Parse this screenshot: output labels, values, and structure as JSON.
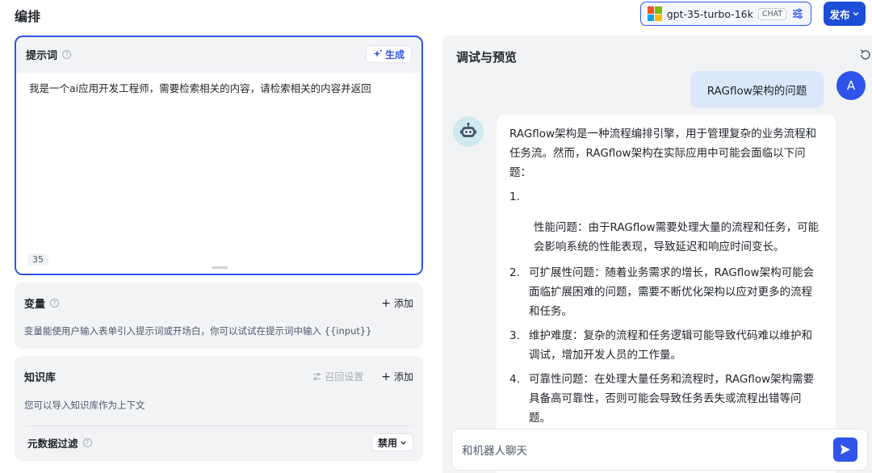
{
  "header": {
    "title": "编排",
    "model": {
      "name": "gpt-35-turbo-16k",
      "badge": "CHAT",
      "icon": "microsoft-logo"
    },
    "publish_label": "发布",
    "colors": {
      "accent": "#2f54eb",
      "publish": "#1d4ed8"
    }
  },
  "prompt": {
    "label": "提示词",
    "generate_label": "生成",
    "text": "我是一个ai应用开发工程师，需要检索相关的内容，请检索相关的内容并返回",
    "char_count": "35"
  },
  "variables": {
    "label": "变量",
    "add_label": "添加",
    "description": "变量能使用户输入表单引入提示词或开场白，你可以试试在提示词中输入 {{input}}"
  },
  "knowledge": {
    "label": "知识库",
    "recall_label": "召回设置",
    "add_label": "添加",
    "description": "您可以导入知识库作为上下文",
    "metadata_filter_label": "元数据过滤",
    "metadata_filter_value": "禁用"
  },
  "preview": {
    "title": "调试与预览",
    "user_message": "RAGflow架构的问题",
    "user_avatar": "A",
    "bot_intro": "RAGflow架构是一种流程编排引擎，用于管理复杂的业务流程和任务流。然而，RAGflow架构在实际应用中可能会面临以下问题：",
    "issues": [
      {
        "num": "1.",
        "text": "性能问题：由于RAGflow需要处理大量的流程和任务，可能会影响系统的性能表现，导致延迟和响应时间变长。"
      },
      {
        "num": "2.",
        "text": "可扩展性问题：随着业务需求的增长，RAGflow架构可能会面临扩展困难的问题，需要不断优化架构以应对更多的流程和任务。"
      },
      {
        "num": "3.",
        "text": "维护难度：复杂的流程和任务逻辑可能导致代码难以维护和调试，增加开发人员的工作量。"
      },
      {
        "num": "4.",
        "text": "可靠性问题：在处理大量任务和流程时，RAGflow架构需要具备高可靠性，否则可能会导致任务丢失或流程出错等问题。"
      }
    ],
    "input_placeholder": "和机器人聊天"
  }
}
